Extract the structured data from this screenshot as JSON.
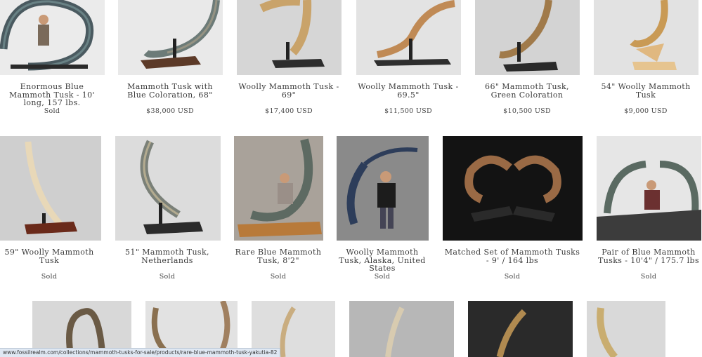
{
  "products": [
    {
      "title": "Enormous Blue Mammoth Tusk - 10' long, 157 lbs.",
      "price": "Sold"
    },
    {
      "title": "Mammoth Tusk with Blue Coloration, 68\"",
      "price": "$38,000 USD"
    },
    {
      "title": "Woolly Mammoth Tusk - 69\"",
      "price": "$17,400 USD"
    },
    {
      "title": "Woolly Mammoth Tusk - 69.5\"",
      "price": "$11,500 USD"
    },
    {
      "title": "66\" Mammoth Tusk, Green Coloration",
      "price": "$10,500 USD"
    },
    {
      "title": "54\" Woolly Mammoth Tusk",
      "price": "$9,000 USD"
    },
    {
      "title": "59\" Woolly Mammoth Tusk",
      "price": "Sold"
    },
    {
      "title": "51\" Mammoth Tusk, Netherlands",
      "price": "Sold"
    },
    {
      "title": "Rare Blue Mammoth Tusk, 8'2\"",
      "price": "Sold"
    },
    {
      "title": "Woolly Mammoth Tusk, Alaska, United States",
      "price": "Sold"
    },
    {
      "title": "Matched Set of Mammoth Tusks - 9' / 164 lbs",
      "price": "Sold"
    },
    {
      "title": "Pair of Blue Mammoth Tusks - 10'4\" / 175.7 lbs",
      "price": "Sold"
    }
  ],
  "status_url": "www.fossilrealm.com/collections/mammoth-tusks-for-sale/products/rare-blue-mammoth-tusk-yakutia-82"
}
